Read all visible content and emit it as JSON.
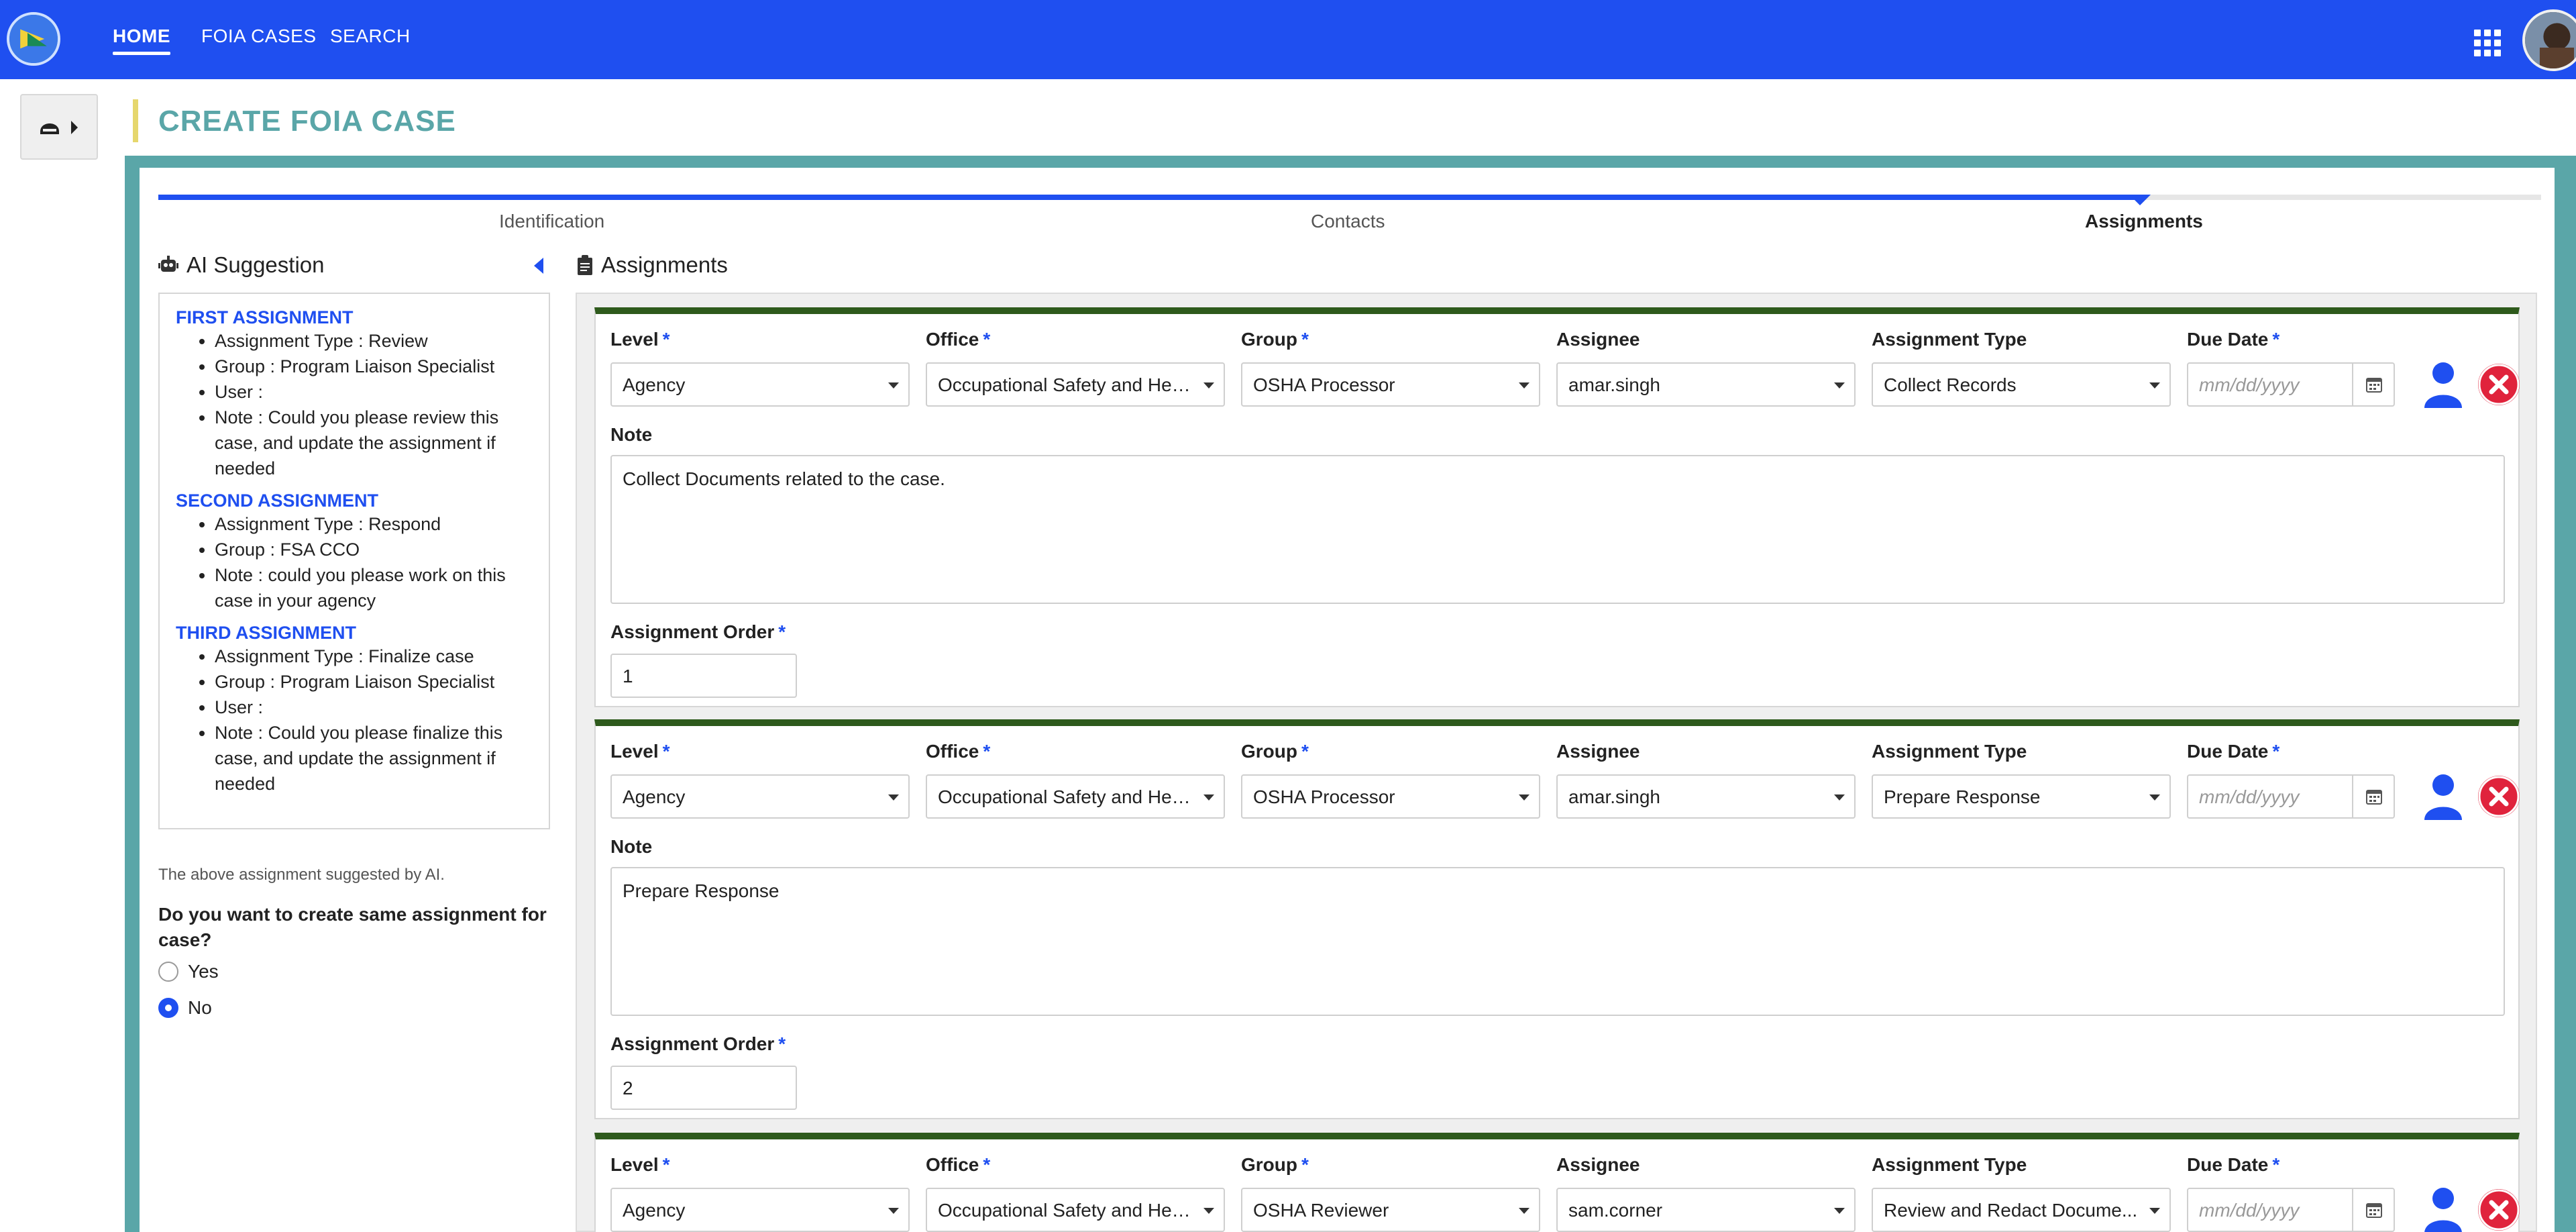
{
  "nav": {
    "items": [
      {
        "label": "HOME",
        "active": true
      },
      {
        "label": "FOIA CASES",
        "active": false
      },
      {
        "label": "SEARCH",
        "active": false
      }
    ]
  },
  "page": {
    "title": "CREATE FOIA CASE"
  },
  "stepper": {
    "steps": [
      {
        "label": "Identification",
        "current": false
      },
      {
        "label": "Contacts",
        "current": false
      },
      {
        "label": "Assignments",
        "current": true
      }
    ]
  },
  "ai": {
    "title": "AI Suggestion",
    "sections": [
      {
        "title": "FIRST ASSIGNMENT",
        "items": [
          "Assignment Type : Review",
          "Group : Program Liaison Specialist",
          "User :",
          "Note : Could you please review this case, and update the assignment if needed"
        ]
      },
      {
        "title": "SECOND ASSIGNMENT",
        "items": [
          "Assignment Type : Respond",
          "Group : FSA CCO",
          "Note : could you please work on this case in your agency"
        ]
      },
      {
        "title": "THIRD ASSIGNMENT",
        "items": [
          "Assignment Type : Finalize  case",
          "Group : Program Liaison Specialist",
          "User :",
          "Note : Could you please finalize this case, and update the assignment if needed"
        ]
      }
    ],
    "disclaimer": "The above assignment suggested by AI.",
    "question": "Do you want to create same assignment for case?",
    "options": [
      {
        "label": "Yes",
        "selected": false
      },
      {
        "label": "No",
        "selected": true
      }
    ]
  },
  "assignments": {
    "title": "Assignments",
    "labels": {
      "level": "Level",
      "office": "Office",
      "group": "Group",
      "assignee": "Assignee",
      "type": "Assignment Type",
      "due": "Due Date",
      "note": "Note",
      "order": "Assignment Order",
      "required": "*"
    },
    "date_placeholder": "mm/dd/yyyy",
    "cards": [
      {
        "level": "Agency",
        "office": "Occupational Safety and Hea...",
        "group": "OSHA Processor",
        "assignee": "amar.singh",
        "type": "Collect Records",
        "note": "Collect Documents related to the case.",
        "order": "1"
      },
      {
        "level": "Agency",
        "office": "Occupational Safety and Hea...",
        "group": "OSHA Processor",
        "assignee": "amar.singh",
        "type": "Prepare Response",
        "note": "Prepare Response",
        "order": "2"
      },
      {
        "level": "Agency",
        "office": "Occupational Safety and Hea...",
        "group": "OSHA Reviewer",
        "assignee": "sam.corner",
        "type": "Review and Redact Docume...",
        "note": "",
        "order": ""
      }
    ]
  },
  "colors": {
    "brand_blue": "#1f4ff0",
    "teal": "#5aa6a8",
    "card_border": "#2e5a1c",
    "danger": "#e0233c"
  }
}
